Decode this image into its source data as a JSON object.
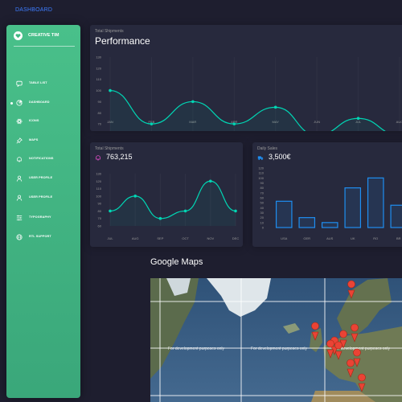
{
  "topbar": {
    "brand": "DASHBOARD"
  },
  "sidebar": {
    "logo_icon": "heart-icon",
    "app_name": "CREATIVE TIM",
    "items": [
      {
        "label": "TABLE LIST",
        "icon": "chat-icon"
      },
      {
        "label": "DASHBOARD",
        "icon": "chart-pie-icon",
        "active": true
      },
      {
        "label": "ICONS",
        "icon": "atom-icon"
      },
      {
        "label": "MAPS",
        "icon": "pin-icon"
      },
      {
        "label": "NOTIFICATIONS",
        "icon": "bell-icon"
      },
      {
        "label": "USER PROFILE",
        "icon": "user-icon"
      },
      {
        "label": "USER PROFILE",
        "icon": "user-icon"
      },
      {
        "label": "TYPOGRAPHY",
        "icon": "align-icon"
      },
      {
        "label": "RTL SUPPORT",
        "icon": "world-icon"
      }
    ]
  },
  "performance": {
    "category": "Total Shipments",
    "title": "Performance"
  },
  "shipments": {
    "category": "Total Shipments",
    "value": "763,215",
    "icon": "bell-icon"
  },
  "sales": {
    "category": "Daily Sales",
    "value": "3,500€",
    "icon": "delivery-icon"
  },
  "maps": {
    "title": "Google Maps",
    "watermark": "For development purposes only"
  },
  "colors": {
    "accent": "#00d6b4",
    "bar": "#1f8ef1",
    "sidebar": "#42b883",
    "brand": "#3d7cff"
  },
  "chart_data": [
    {
      "type": "line",
      "categories": [
        "JAN",
        "FEB",
        "MAR",
        "APR",
        "MAY",
        "JUN",
        "JUL",
        "AUG"
      ],
      "values": [
        100,
        70,
        90,
        70,
        85,
        60,
        75,
        60
      ],
      "yticks": [
        60,
        70,
        80,
        90,
        100,
        110,
        120,
        130
      ],
      "ylim": [
        60,
        130
      ]
    },
    {
      "type": "line",
      "categories": [
        "JUL",
        "AUG",
        "SEP",
        "OCT",
        "NOV",
        "DEC"
      ],
      "values": [
        80,
        100,
        70,
        80,
        120,
        80
      ],
      "yticks": [
        60,
        70,
        80,
        90,
        100,
        110,
        120,
        130
      ],
      "ylim": [
        60,
        130
      ]
    },
    {
      "type": "bar",
      "categories": [
        "USA",
        "GER",
        "AUS",
        "UK",
        "RO",
        "BR"
      ],
      "values": [
        53,
        20,
        10,
        80,
        100,
        45
      ],
      "yticks": [
        0,
        10,
        20,
        30,
        40,
        50,
        60,
        70,
        80,
        90,
        100,
        110,
        120
      ],
      "ylim": [
        0,
        120
      ]
    }
  ]
}
